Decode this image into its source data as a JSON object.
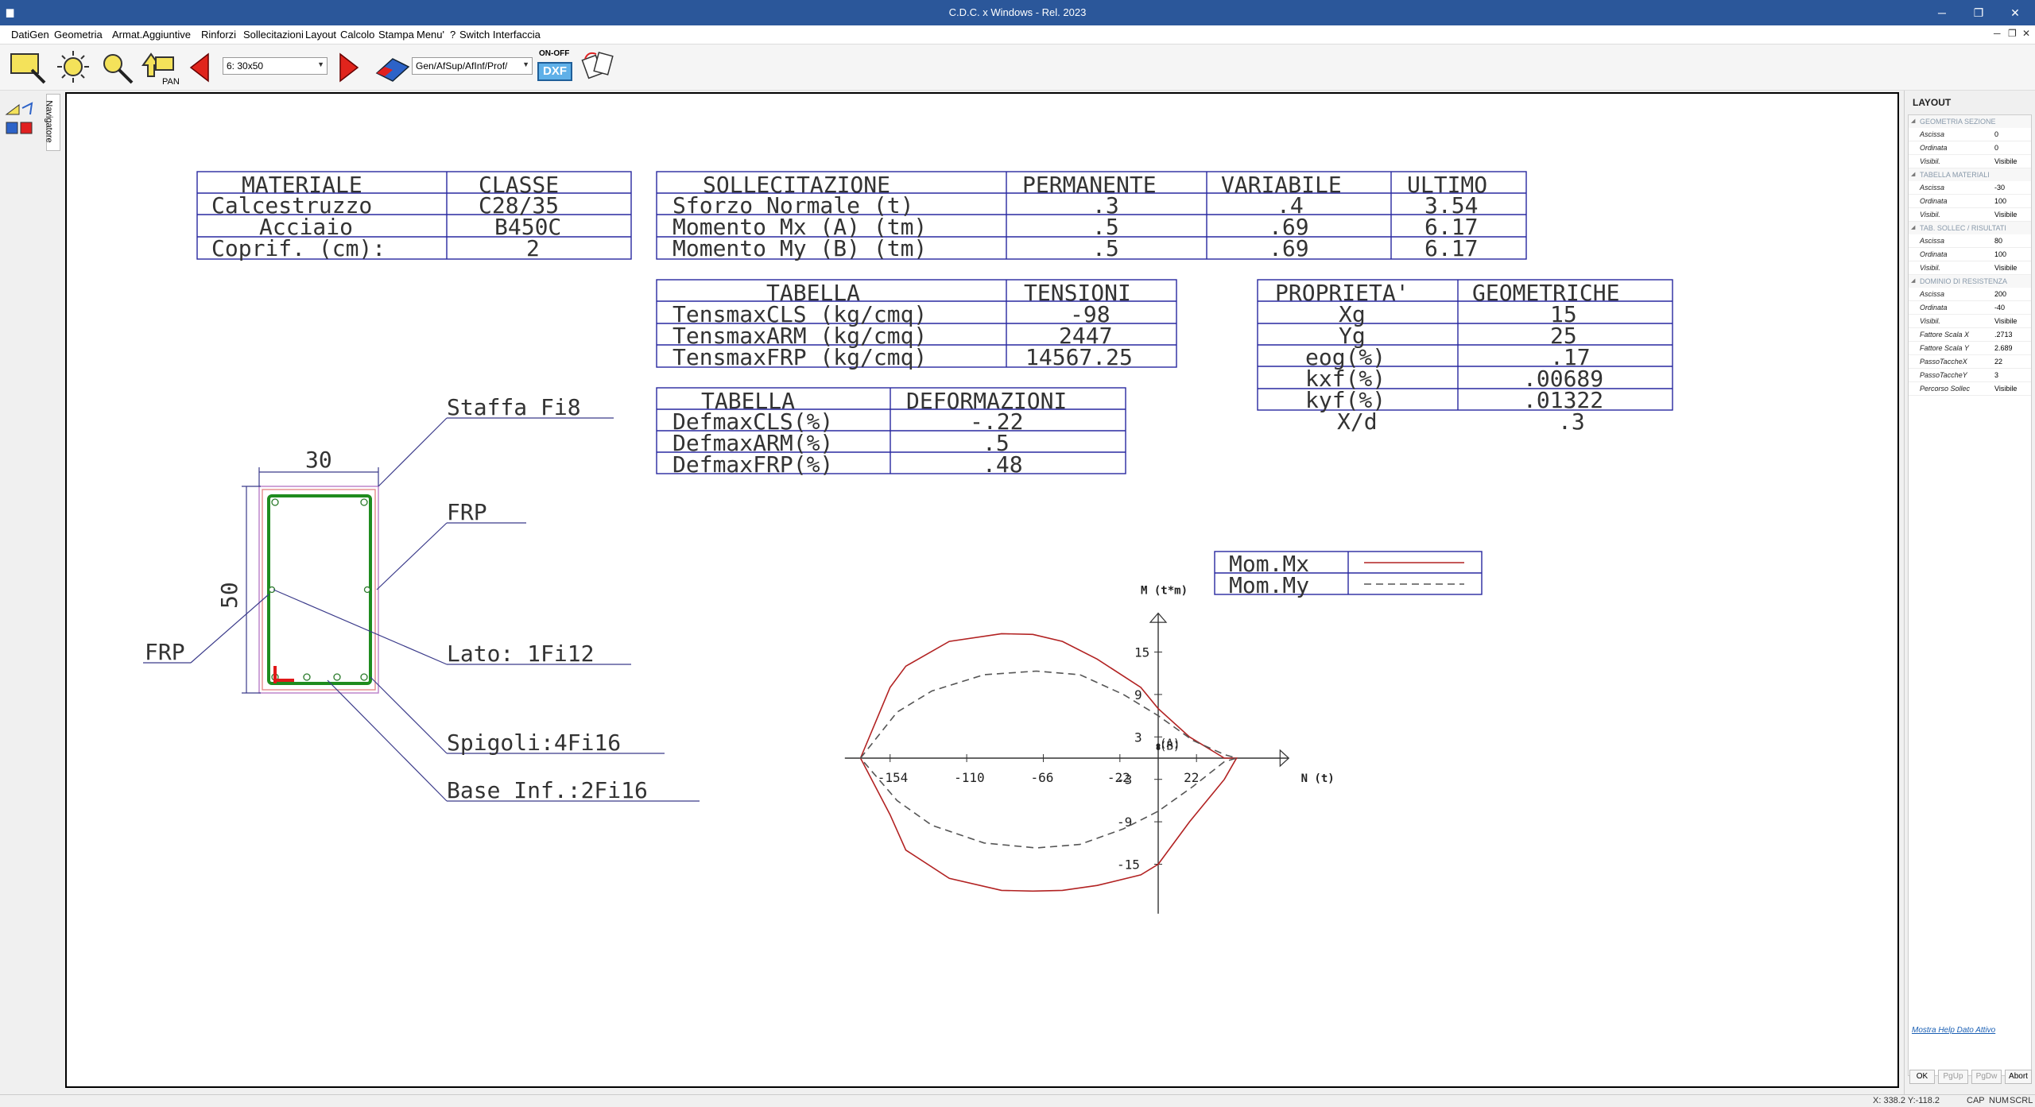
{
  "window": {
    "title": "C.D.C. x Windows - Rel. 2023"
  },
  "menu": [
    "DatiGen",
    "Geometria",
    "Armat.Aggiuntive",
    "Rinforzi",
    "Sollecitazioni",
    "Layout",
    "Calcolo",
    "Stampa",
    "Menu'",
    "?",
    "Switch Interfaccia"
  ],
  "toolbar": {
    "section_combo": "6: 30x50",
    "view_combo": "Gen/AfSup/AfInf/Prof/",
    "onoff_label": "ON-OFF",
    "dxf_label": "DXF",
    "pan_label": "PAN"
  },
  "side_tab": "Navigatore",
  "materials_table": {
    "headers": [
      "MATERIALE",
      "CLASSE"
    ],
    "rows": [
      [
        "Calcestruzzo",
        "C28/35"
      ],
      [
        "Acciaio",
        "B450C"
      ],
      [
        "Coprif. (cm):",
        "2"
      ]
    ]
  },
  "loads_table": {
    "headers": [
      "SOLLECITAZIONE",
      "PERMANENTE",
      "VARIABILE",
      "ULTIMO"
    ],
    "rows": [
      [
        "Sforzo Normale (t)",
        ".3",
        ".4",
        "3.54"
      ],
      [
        "Momento Mx (A) (tm)",
        ".5",
        ".69",
        "6.17"
      ],
      [
        "Momento My (B) (tm)",
        ".5",
        ".69",
        "6.17"
      ]
    ]
  },
  "stress_table": {
    "headers": [
      "TABELLA",
      "TENSIONI"
    ],
    "rows": [
      [
        "TensmaxCLS (kg/cmq)",
        "-98"
      ],
      [
        "TensmaxARM (kg/cmq)",
        "2447"
      ],
      [
        "TensmaxFRP (kg/cmq)",
        "14567.25"
      ]
    ]
  },
  "strain_table": {
    "headers": [
      "TABELLA",
      "DEFORMAZIONI"
    ],
    "rows": [
      [
        "DefmaxCLS(%)",
        "-.22"
      ],
      [
        "DefmaxARM(%)",
        ".5"
      ],
      [
        "DefmaxFRP(%)",
        ".48"
      ]
    ]
  },
  "geom_table": {
    "headers": [
      "PROPRIETA'",
      "GEOMETRICHE"
    ],
    "rows": [
      [
        "Xg",
        "15"
      ],
      [
        "Yg",
        "25"
      ],
      [
        "eog(%)",
        ".17"
      ],
      [
        "kxf(%)",
        ".00689"
      ],
      [
        "kyf(%)",
        ".01322"
      ],
      [
        "X/d",
        ".3"
      ]
    ]
  },
  "section": {
    "width_label": "30",
    "height_label": "50",
    "labels": {
      "stirrup": "Staffa Fi8",
      "frp_right": "FRP",
      "frp_left": "FRP",
      "side": "Lato: 1Fi12",
      "corners": "Spigoli:4Fi16",
      "bottom": "Base Inf.:2Fi16"
    }
  },
  "legend": [
    {
      "name": "Mom.Mx",
      "style": "solid"
    },
    {
      "name": "Mom.My",
      "style": "dashed"
    }
  ],
  "chart_data": {
    "type": "line",
    "title": "",
    "xlabel": "N (t)",
    "ylabel": "M (t*m)",
    "x_ticks": [
      -154,
      -110,
      -66,
      -22,
      22
    ],
    "y_ticks": [
      15,
      9,
      3,
      -3,
      -9,
      -15
    ],
    "point_labels": [
      "(A)",
      "(B)"
    ],
    "series": [
      {
        "name": "Mom.Mx",
        "color": "#b22222",
        "style": "solid",
        "x": [
          -171,
          -154,
          -145,
          -120,
          -90,
          -72,
          -55,
          -35,
          -10,
          0,
          18,
          38,
          45,
          38,
          18,
          0,
          -10,
          -35,
          -55,
          -72,
          -90,
          -120,
          -145,
          -154,
          -171
        ],
        "y": [
          0,
          10,
          13,
          16.5,
          17.6,
          17.5,
          16.5,
          14,
          10,
          7,
          3,
          0,
          0,
          -3,
          -9,
          -15,
          -16.5,
          -18,
          -18.7,
          -18.8,
          -18.7,
          -17,
          -13,
          -8,
          0
        ]
      },
      {
        "name": "Mom.My",
        "color": "#555555",
        "style": "dashed",
        "x": [
          -171,
          -150,
          -130,
          -100,
          -70,
          -45,
          -20,
          0,
          20,
          38,
          45,
          38,
          20,
          0,
          -20,
          -45,
          -70,
          -100,
          -130,
          -150,
          -171
        ],
        "y": [
          0,
          6.5,
          9.5,
          11.8,
          12.3,
          11.8,
          9,
          6,
          2.5,
          0.5,
          0,
          -0.5,
          -4,
          -7.5,
          -10,
          -12.2,
          -12.7,
          -12,
          -9.5,
          -6,
          0
        ]
      }
    ],
    "marker_points": [
      [
        0,
        1.8
      ],
      [
        0,
        1.4
      ]
    ]
  },
  "right_panel": {
    "header": "LAYOUT",
    "groups": [
      {
        "title": "GEOMETRIA SEZIONE",
        "rows": [
          [
            "Ascissa",
            "0"
          ],
          [
            "Ordinata",
            "0"
          ],
          [
            "Visibil.",
            "Visibile"
          ]
        ]
      },
      {
        "title": "TABELLA MATERIALI",
        "rows": [
          [
            "Ascissa",
            "-30"
          ],
          [
            "Ordinata",
            "100"
          ],
          [
            "Visibil.",
            "Visibile"
          ]
        ]
      },
      {
        "title": "TAB. SOLLEC / RISULTATI",
        "rows": [
          [
            "Ascissa",
            "80"
          ],
          [
            "Ordinata",
            "100"
          ],
          [
            "Visibil.",
            "Visibile"
          ]
        ]
      },
      {
        "title": "DOMINIO DI RESISTENZA",
        "rows": [
          [
            "Ascissa",
            "200"
          ],
          [
            "Ordinata",
            "-40"
          ],
          [
            "Visibil.",
            "Visibile"
          ],
          [
            "Fattore Scala X",
            ".2713"
          ],
          [
            "Fattore Scala Y",
            "2.689"
          ],
          [
            "PassoTaccheX",
            "22"
          ],
          [
            "PassoTaccheY",
            "3"
          ],
          [
            "Percorso Sollec",
            "Visibile"
          ]
        ]
      }
    ],
    "help_link": "Mostra Help Dato Attivo",
    "buttons": [
      "OK",
      "PgUp",
      "PgDw",
      "Abort"
    ]
  },
  "status": {
    "coords": "X: 338.2  Y:-118.2",
    "cap": "CAP",
    "num": "NUM",
    "scrl": "SCRL"
  }
}
